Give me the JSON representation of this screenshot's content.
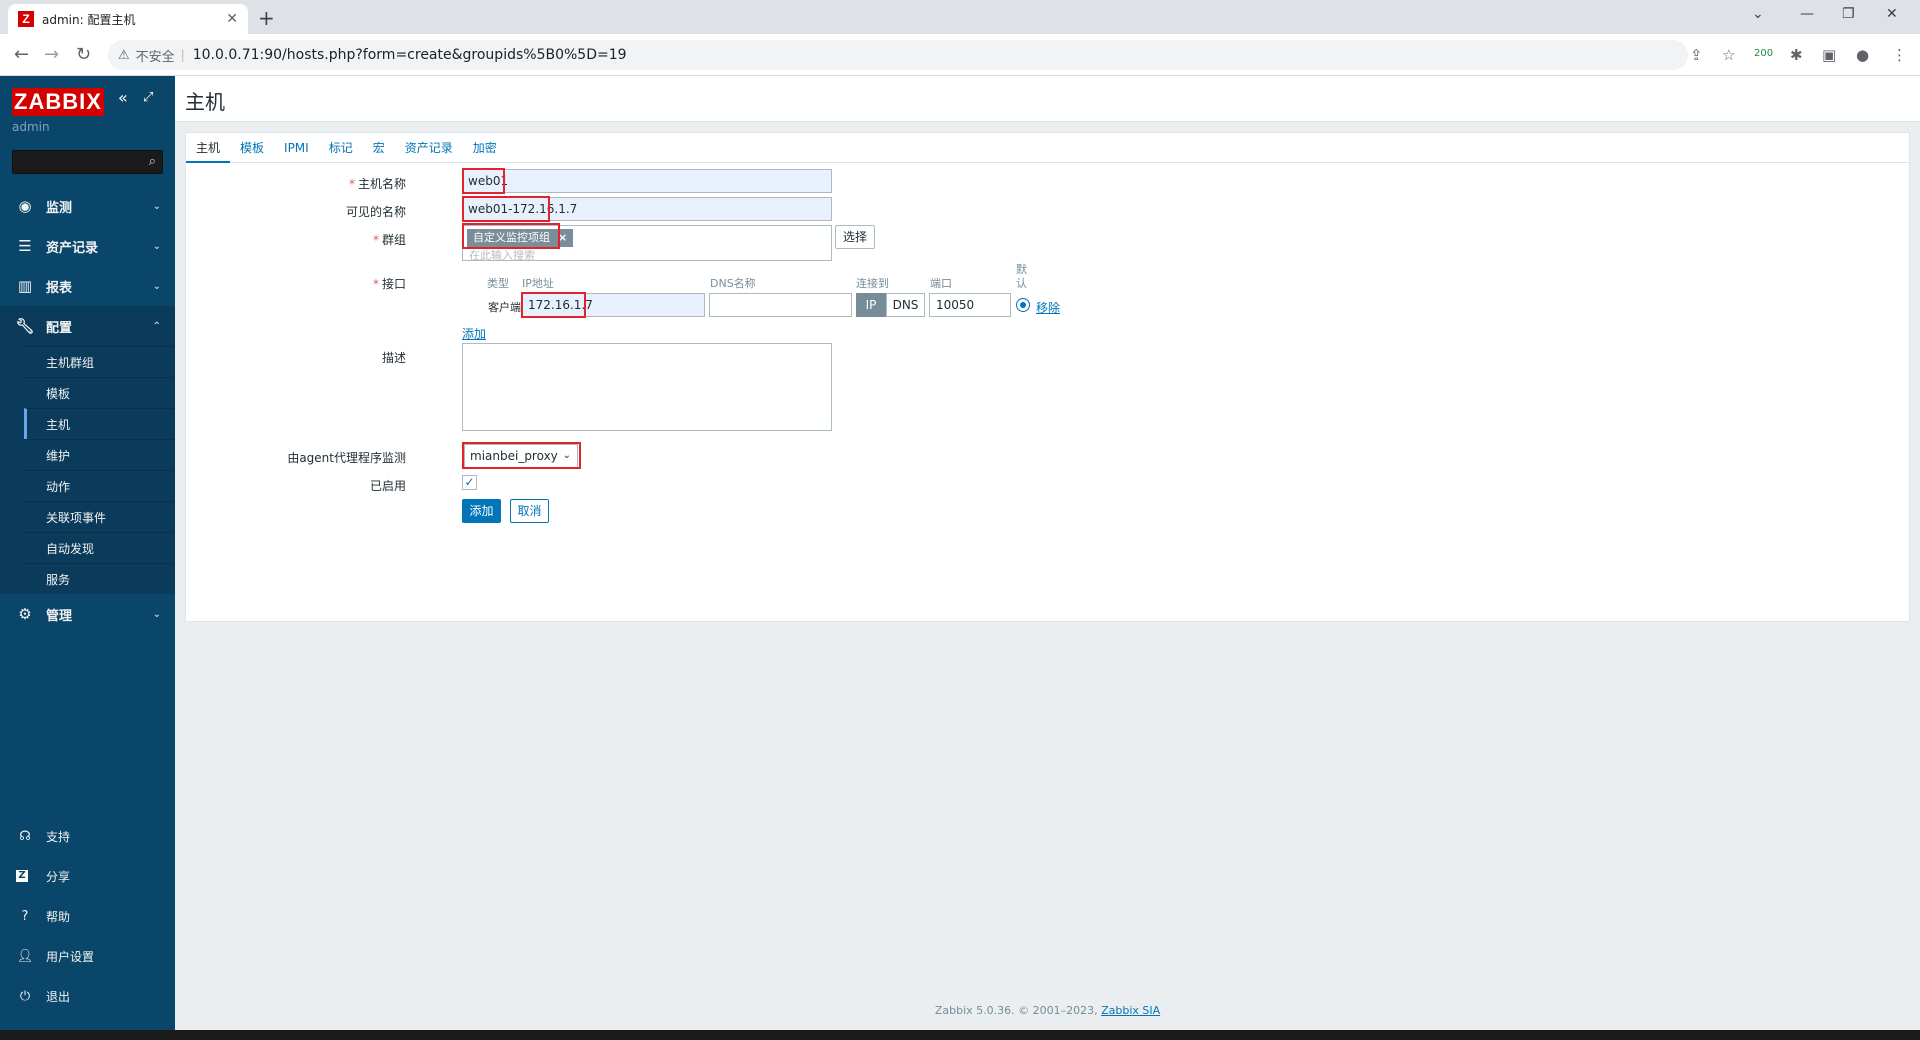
{
  "browser": {
    "tab_title": "admin: 配置主机",
    "favicon": "Z",
    "insecure_label": "不安全",
    "url": "10.0.0.71:90/hosts.php?form=create&groupids%5B0%5D=19",
    "ext_badge": "200"
  },
  "sidebar": {
    "logo": "ZABBIX",
    "user": "admin",
    "menu": [
      {
        "label": "监测",
        "icon": "eye-icon"
      },
      {
        "label": "资产记录",
        "icon": "list-icon"
      },
      {
        "label": "报表",
        "icon": "chart-icon"
      },
      {
        "label": "配置",
        "icon": "wrench-icon"
      }
    ],
    "submenu": [
      "主机群组",
      "模板",
      "主机",
      "维护",
      "动作",
      "关联项事件",
      "自动发现",
      "服务"
    ],
    "admin": {
      "label": "管理",
      "icon": "gear-icon"
    },
    "bottom": [
      "支持",
      "分享",
      "帮助",
      "用户设置",
      "退出"
    ]
  },
  "page": {
    "title": "主机",
    "tabs": [
      "主机",
      "模板",
      "IPMI",
      "标记",
      "宏",
      "资产记录",
      "加密"
    ],
    "form": {
      "host_name_label": "主机名称",
      "host_name": "web01",
      "visible_name_label": "可见的名称",
      "visible_name": "web01-172.16.1.7",
      "groups_label": "群组",
      "group_chip": "自定义监控项组",
      "groups_placeholder": "在此输入搜索",
      "select_button": "选择",
      "interfaces_label": "接口",
      "col_type": "类型",
      "col_ip": "IP地址",
      "col_dns": "DNS名称",
      "col_connect": "连接到",
      "col_port": "端口",
      "col_default": "默认",
      "iface_type": "客户端",
      "ip": "172.16.1.7",
      "dns": "",
      "connect_ip": "IP",
      "connect_dns": "DNS",
      "port": "10050",
      "remove_link": "移除",
      "add_link": "添加",
      "description_label": "描述",
      "proxy_label": "由agent代理程序监测",
      "proxy_value": "mianbei_proxy",
      "enabled_label": "已启用",
      "add_button": "添加",
      "cancel_button": "取消"
    }
  },
  "footer": {
    "text": "Zabbix 5.0.36. © 2001–2023, ",
    "link": "Zabbix SIA"
  }
}
